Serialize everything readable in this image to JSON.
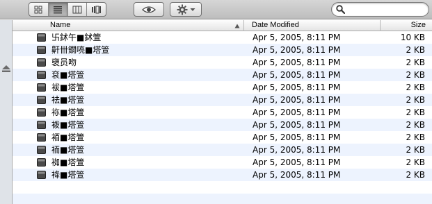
{
  "search": {
    "value": "",
    "placeholder": ""
  },
  "columns": {
    "name": "Name",
    "date": "Date Modified",
    "size": "Size"
  },
  "files": [
    {
      "name": "卐鉥午■鉥箮",
      "date": "Apr 5, 2005, 8:11 PM",
      "size": "10 KB"
    },
    {
      "name": "鼾卌鐗喨■塔箮",
      "date": "Apr 5, 2005, 8:11 PM",
      "size": "2 KB"
    },
    {
      "name": "褏员吻",
      "date": "Apr 5, 2005, 8:11 PM",
      "size": "2 KB"
    },
    {
      "name": "袞■塔箮",
      "date": "Apr 5, 2005, 8:11 PM",
      "size": "2 KB"
    },
    {
      "name": "袚■塔箮",
      "date": "Apr 5, 2005, 8:11 PM",
      "size": "2 KB"
    },
    {
      "name": "袪■塔箮",
      "date": "Apr 5, 2005, 8:11 PM",
      "size": "2 KB"
    },
    {
      "name": "袮■塔箮",
      "date": "Apr 5, 2005, 8:11 PM",
      "size": "2 KB"
    },
    {
      "name": "袯■塔箮",
      "date": "Apr 5, 2005, 8:11 PM",
      "size": "2 KB"
    },
    {
      "name": "袹■塔箮",
      "date": "Apr 5, 2005, 8:11 PM",
      "size": "2 KB"
    },
    {
      "name": "袻■塔箮",
      "date": "Apr 5, 2005, 8:11 PM",
      "size": "2 KB"
    },
    {
      "name": "袽■塔箮",
      "date": "Apr 5, 2005, 8:11 PM",
      "size": "2 KB"
    },
    {
      "name": "袶■塔箮",
      "date": "Apr 5, 2005, 8:11 PM",
      "size": "2 KB"
    }
  ],
  "icons": {
    "view_buttons": [
      "icon-view-icon",
      "list-view-icon",
      "column-view-icon",
      "cover-flow-icon"
    ],
    "quick_look": "eye-icon",
    "action": "gear-icon",
    "search": "magnifier-icon",
    "eject": "eject-icon",
    "file": "file-icon"
  }
}
